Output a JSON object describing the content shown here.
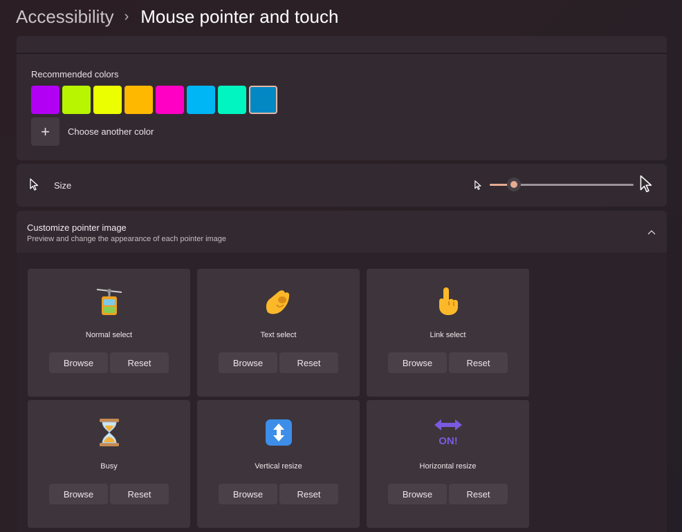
{
  "breadcrumb": {
    "parent": "Accessibility",
    "separator": "›",
    "current": "Mouse pointer and touch"
  },
  "colors": {
    "recommended_label": "Recommended colors",
    "swatches": [
      "#b200f5",
      "#b7f500",
      "#ecff00",
      "#ffb800",
      "#ff00c4",
      "#00b6f5",
      "#00f5c0",
      "#0388c4"
    ],
    "selected_index": 7,
    "add_symbol": "+",
    "choose_label": "Choose another color"
  },
  "size": {
    "label": "Size",
    "slider_value": 0.17,
    "accent": "#e7ab92"
  },
  "customize": {
    "title": "Customize pointer image",
    "subtitle": "Preview and change the appearance of each pointer image",
    "chevron": "^"
  },
  "pointers": [
    {
      "label": "Normal select",
      "icon": "aerial-tramway-icon",
      "browse": "Browse",
      "reset": "Reset"
    },
    {
      "label": "Text select",
      "icon": "pinching-hand-icon",
      "browse": "Browse",
      "reset": "Reset"
    },
    {
      "label": "Link select",
      "icon": "pointing-hand-icon",
      "browse": "Browse",
      "reset": "Reset"
    },
    {
      "label": "Busy",
      "icon": "hourglass-icon",
      "browse": "Browse",
      "reset": "Reset"
    },
    {
      "label": "Vertical resize",
      "icon": "up-down-arrow-icon",
      "browse": "Browse",
      "reset": "Reset"
    },
    {
      "label": "Horizontal resize",
      "icon": "on-arrow-icon",
      "browse": "Browse",
      "reset": "Reset",
      "icon_text": "ON!"
    }
  ]
}
